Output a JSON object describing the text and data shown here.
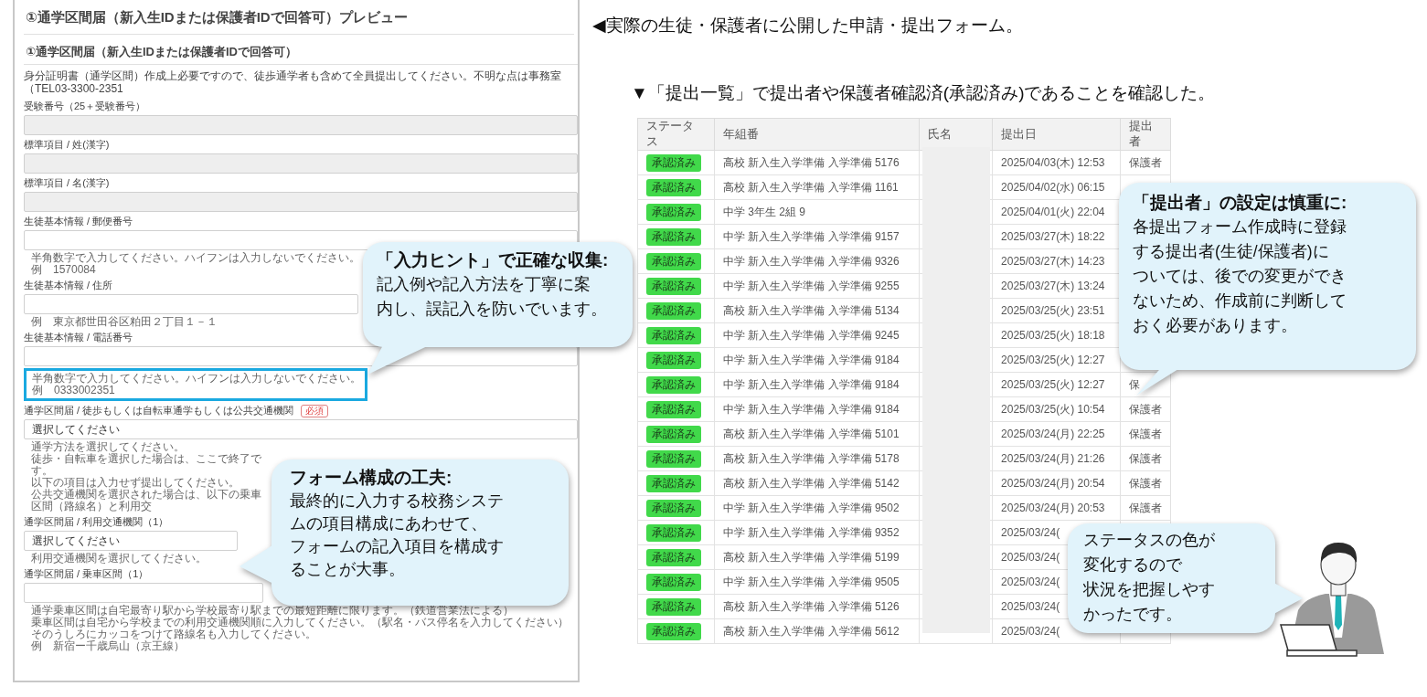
{
  "form": {
    "title": "①通学区間届（新入生IDまたは保護者IDで回答可）プレビュー",
    "section_title": "①通学区間届（新入生IDまたは保護者IDで回答可）",
    "description": "身分証明書（通学区間）作成上必要ですので、徒歩通学者も含めて全員提出してください。不明な点は事務室（TEL03-3300-2351",
    "fields": [
      {
        "label": "受験番号（25＋受験番号）",
        "kind": "text",
        "disabled": true
      },
      {
        "label": "標準項目 / 姓(漢字)",
        "kind": "text",
        "disabled": true
      },
      {
        "label": "標準項目 / 名(漢字)",
        "kind": "text",
        "disabled": true
      },
      {
        "label": "生徒基本情報 / 郵便番号",
        "kind": "text",
        "disabled": false,
        "hints": [
          "半角数字で入力してください。ハイフンは入力しないでください。",
          "例　1570084"
        ]
      },
      {
        "label": "生徒基本情報 / 住所",
        "kind": "text",
        "disabled": false,
        "hints": [
          "例　東京都世田谷区粕田２丁目１－１"
        ]
      },
      {
        "label": "生徒基本情報 / 電話番号",
        "kind": "text",
        "disabled": false,
        "highlighted": true,
        "hints": [
          "半角数字で入力してください。ハイフンは入力しないでください。",
          "例　0333002351"
        ]
      },
      {
        "label": "通学区間届 / 徒歩もしくは自転車通学もしくは公共交通機関",
        "badge": "必須",
        "kind": "select",
        "disabled": false,
        "value": "選択してください",
        "hints": [
          "通学方法を選択してください。",
          "徒歩・自転車を選択した場合は、ここで終了です。",
          "以下の項目は入力せず提出してください。",
          "公共交通機関を選択された場合は、以下の乗車区間（路線名）と利用交"
        ]
      },
      {
        "label": "通学区間届 / 利用交通機関（1）",
        "kind": "select",
        "disabled": false,
        "value": "選択してください",
        "hints": [
          "利用交通機関を選択してください。"
        ]
      },
      {
        "label": "通学区間届 / 乗車区間（1）",
        "kind": "text",
        "disabled": false,
        "hints": [
          "通学乗車区間は自宅最寄り駅から学校最寄り駅までの最短距離に限ります。（鉄道営業法による）",
          "乗車区間は自宅から学校までの利用交通機関順に入力してください。（駅名・バス停名を入力してください）そのうしろにカッコをつけて路線名も入力してください。",
          "例　新宿ー千歳烏山（京王線）"
        ]
      }
    ]
  },
  "heading_form": "◀実際の生徒・保護者に公開した申請・提出フォーム。",
  "heading_list": "▼「提出一覧」で提出者や保護者確認済(承認済み)であることを確認した。",
  "table": {
    "columns": [
      "ステータス",
      "年組番",
      "氏名",
      "提出日",
      "提出者"
    ],
    "rows": [
      {
        "status": "承認済み",
        "class": "高校 新入生入学準備 入学準備 5176",
        "date": "2025/04/03(木) 12:53",
        "submitter": "保護者"
      },
      {
        "status": "承認済み",
        "class": "高校 新入生入学準備 入学準備 1161",
        "date": "2025/04/02(水) 06:15"
      },
      {
        "status": "承認済み",
        "class": "中学 3年生 2組 9",
        "date": "2025/04/01(火) 22:04"
      },
      {
        "status": "承認済み",
        "class": "中学 新入生入学準備 入学準備 9157",
        "date": "2025/03/27(木) 18:22"
      },
      {
        "status": "承認済み",
        "class": "中学 新入生入学準備 入学準備 9326",
        "date": "2025/03/27(木) 14:23"
      },
      {
        "status": "承認済み",
        "class": "中学 新入生入学準備 入学準備 9255",
        "date": "2025/03/27(木) 13:24"
      },
      {
        "status": "承認済み",
        "class": "高校 新入生入学準備 入学準備 5134",
        "date": "2025/03/25(火) 23:51"
      },
      {
        "status": "承認済み",
        "class": "中学 新入生入学準備 入学準備 9245",
        "date": "2025/03/25(火) 18:18"
      },
      {
        "status": "承認済み",
        "class": "中学 新入生入学準備 入学準備 9184",
        "date": "2025/03/25(火) 12:27"
      },
      {
        "status": "承認済み",
        "class": "中学 新入生入学準備 入学準備 9184",
        "date": "2025/03/25(火) 12:27",
        "submitter": "保"
      },
      {
        "status": "承認済み",
        "class": "中学 新入生入学準備 入学準備 9184",
        "date": "2025/03/25(火) 10:54",
        "submitter": "保護者"
      },
      {
        "status": "承認済み",
        "class": "高校 新入生入学準備 入学準備 5101",
        "date": "2025/03/24(月) 22:25",
        "submitter": "保護者"
      },
      {
        "status": "承認済み",
        "class": "高校 新入生入学準備 入学準備 5178",
        "date": "2025/03/24(月) 21:26",
        "submitter": "保護者"
      },
      {
        "status": "承認済み",
        "class": "高校 新入生入学準備 入学準備 5142",
        "date": "2025/03/24(月) 20:54",
        "submitter": "保護者"
      },
      {
        "status": "承認済み",
        "class": "中学 新入生入学準備 入学準備 9502",
        "date": "2025/03/24(月) 20:53",
        "submitter": "保護者"
      },
      {
        "status": "承認済み",
        "class": "中学 新入生入学準備 入学準備 9352",
        "date": "2025/03/24("
      },
      {
        "status": "承認済み",
        "class": "高校 新入生入学準備 入学準備 5199",
        "date": "2025/03/24("
      },
      {
        "status": "承認済み",
        "class": "中学 新入生入学準備 入学準備 9505",
        "date": "2025/03/24("
      },
      {
        "status": "承認済み",
        "class": "高校 新入生入学準備 入学準備 5126",
        "date": "2025/03/24("
      },
      {
        "status": "承認済み",
        "class": "高校 新入生入学準備 入学準備 5612",
        "date": "2025/03/24("
      }
    ]
  },
  "callouts": [
    {
      "title": "「入力ヒント」で正確な収集:",
      "lines": [
        "記入例や記入方法を丁寧に案",
        "内し、誤記入を防いでいます。"
      ]
    },
    {
      "title": "フォーム構成の工夫:",
      "lines": [
        "最終的に入力する校務システ",
        "ムの項目構成にあわせて、",
        "フォームの記入項目を構成す",
        "ることが大事。"
      ]
    },
    {
      "title": "「提出者」の設定は慎重に:",
      "lines": [
        "各提出フォーム作成時に登録",
        "する提出者(生徒/保護者)に",
        "ついては、後での変更ができ",
        "ないため、作成前に判断して",
        "おく必要があります。"
      ]
    },
    {
      "lines": [
        "ステータスの色が",
        "変化するので",
        "状況を把握しやす",
        "かったです。"
      ]
    }
  ]
}
